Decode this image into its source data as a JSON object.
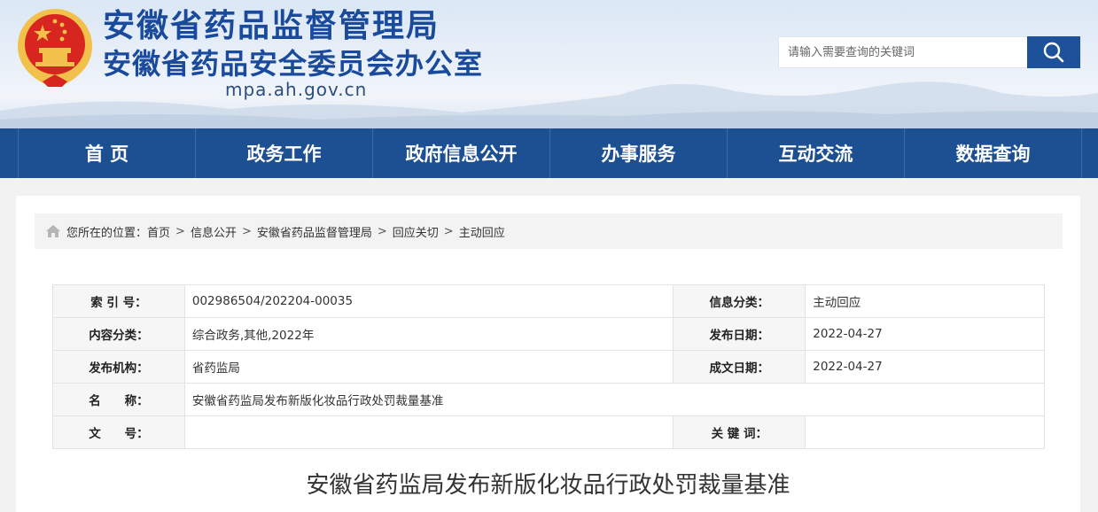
{
  "header": {
    "title_line1": "安徽省药品监督管理局",
    "title_line2": "安徽省药品安全委员会办公室",
    "domain": "mpa.ah.gov.cn",
    "emblem_icon": "national-emblem-icon"
  },
  "search": {
    "placeholder": "请输入需要查询的关键词",
    "button_icon": "search-icon"
  },
  "nav": {
    "items": [
      {
        "label": "首 页"
      },
      {
        "label": "政务工作"
      },
      {
        "label": "政府信息公开"
      },
      {
        "label": "办事服务"
      },
      {
        "label": "互动交流"
      },
      {
        "label": "数据查询"
      }
    ]
  },
  "breadcrumb": {
    "icon": "home-icon",
    "prefix": "您所在的位置：",
    "separator": ">",
    "items": [
      "首页",
      "信息公开",
      "安徽省药品监督管理局",
      "回应关切",
      "主动回应"
    ]
  },
  "info": {
    "index_label": "索 引 号：",
    "index_value": "002986504/202204-00035",
    "category_label": "信息分类：",
    "category_value": "主动回应",
    "content_label": "内容分类：",
    "content_value": "综合政务,其他,2022年",
    "publish_date_label": "发布日期：",
    "publish_date_value": "2022-04-27",
    "org_label": "发布机构：",
    "org_value": "省药监局",
    "created_date_label": "成文日期：",
    "created_date_value": "2022-04-27",
    "name_label": "名　　称：",
    "name_value": "安徽省药监局发布新版化妆品行政处罚裁量基准",
    "doc_no_label": "文　　号：",
    "doc_no_value": "",
    "keywords_label": "关 键 词：",
    "keywords_value": ""
  },
  "article": {
    "title": "安徽省药监局发布新版化妆品行政处罚裁量基准"
  },
  "colors": {
    "brand_blue": "#1d4f93",
    "title_blue": "#1a4a9c",
    "emblem_red": "#d7261f",
    "emblem_gold": "#f2c14b"
  }
}
